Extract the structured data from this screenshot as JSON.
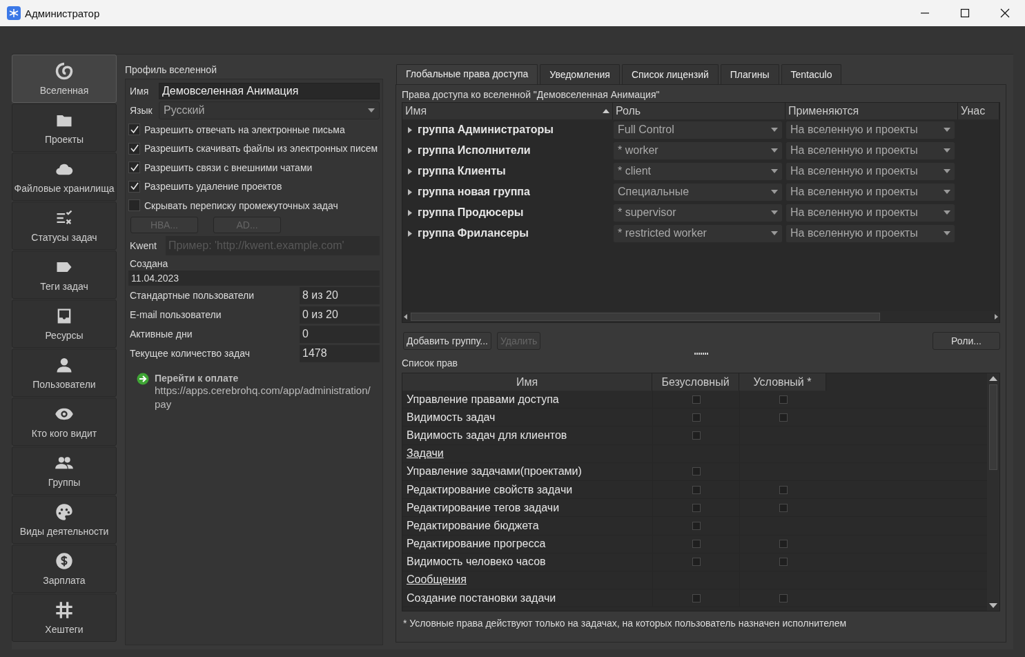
{
  "window": {
    "title": "Администратор"
  },
  "sidebar": {
    "items": [
      {
        "label": "Вселенная",
        "selected": true
      },
      {
        "label": "Проекты",
        "selected": false
      },
      {
        "label": "Файловые хранилища",
        "selected": false
      },
      {
        "label": "Статусы задач",
        "selected": false
      },
      {
        "label": "Теги задач",
        "selected": false
      },
      {
        "label": "Ресурсы",
        "selected": false
      },
      {
        "label": "Пользователи",
        "selected": false
      },
      {
        "label": "Кто кого видит",
        "selected": false
      },
      {
        "label": "Группы",
        "selected": false
      },
      {
        "label": "Виды деятельности",
        "selected": false
      },
      {
        "label": "Зарплата",
        "selected": false
      },
      {
        "label": "Хештеги",
        "selected": false
      }
    ]
  },
  "profile": {
    "title": "Профиль вселенной",
    "name": {
      "label": "Имя",
      "value": "Демовселенная Анимация"
    },
    "language": {
      "label": "Язык",
      "value": "Русский"
    },
    "options": [
      {
        "label": "Разрешить отвечать на электронные письма",
        "checked": true
      },
      {
        "label": "Разрешить скачивать файлы из электронных писем",
        "checked": true
      },
      {
        "label": "Разрешить связи с внешними чатами",
        "checked": true
      },
      {
        "label": "Разрешить удаление проектов",
        "checked": true
      },
      {
        "label": "Скрывать переписку промежуточных задач",
        "checked": false
      }
    ],
    "buttons": [
      {
        "label": "НВА...",
        "disabled": true
      },
      {
        "label": "AD...",
        "disabled": true
      }
    ],
    "kwent": {
      "label": "Kwent",
      "placeholder": "Пример: 'http://kwent.example.com'"
    },
    "created": {
      "label": "Создана",
      "value": "11.04.2023"
    },
    "stats": [
      {
        "label": "Стандартные пользователи",
        "value": "8 из 20"
      },
      {
        "label": "E-mail пользователи",
        "value": "0 из 20"
      },
      {
        "label": "Активные дни",
        "value": "0"
      },
      {
        "label": "Текущее количество задач",
        "value": "1478"
      }
    ],
    "payment": {
      "title": "Перейти к оплате",
      "url": "https://apps.cerebrohq.com/app/administration/pay"
    }
  },
  "tabs": [
    {
      "label": "Глобальные права доступа",
      "selected": true
    },
    {
      "label": "Уведомления",
      "selected": false
    },
    {
      "label": "Список лицензий",
      "selected": false
    },
    {
      "label": "Плагины",
      "selected": false
    },
    {
      "label": "Tentaculo",
      "selected": false
    }
  ],
  "access": {
    "title": "Права доступа ко вселенной \"Демовселенная Анимация\"",
    "columns": [
      {
        "label": "Имя",
        "sorted": true
      },
      {
        "label": "Роль",
        "sorted": false
      },
      {
        "label": "Применяются",
        "sorted": false
      },
      {
        "label": "Унас",
        "sorted": false
      }
    ],
    "rows": [
      {
        "name": "группа Администраторы",
        "role": "Full Control",
        "applies": "На вселенную и проекты",
        "expanded": false
      },
      {
        "name": "группа Исполнители",
        "role": "* worker",
        "applies": "На вселенную и проекты",
        "expanded": false
      },
      {
        "name": "группа Клиенты",
        "role": "* client",
        "applies": "На вселенную и проекты",
        "expanded": false
      },
      {
        "name": "группа новая группа",
        "role": "Специальные",
        "applies": "На вселенную и проекты",
        "expanded": false
      },
      {
        "name": "группа Продюсеры",
        "role": "* supervisor",
        "applies": "На вселенную и проекты",
        "expanded": false
      },
      {
        "name": "группа Фрилансеры",
        "role": "* restricted worker",
        "applies": "На вселенную и проекты",
        "expanded": false
      }
    ],
    "buttons": [
      {
        "label": "Добавить группу...",
        "disabled": false
      },
      {
        "label": "Удалить",
        "disabled": true
      },
      {
        "label": "Роли...",
        "disabled": false
      }
    ]
  },
  "rights": {
    "title": "Список прав",
    "columns": [
      "Имя",
      "Безусловный",
      "Условный *"
    ],
    "rows": [
      {
        "kind": "right",
        "name": "Управление правами доступа",
        "unconditional": false,
        "conditional": false
      },
      {
        "kind": "right",
        "name": "Видимость задач",
        "unconditional": false,
        "conditional": false
      },
      {
        "kind": "right",
        "name": "Видимость задач для клиентов",
        "unconditional": false
      },
      {
        "kind": "section",
        "name": "Задачи"
      },
      {
        "kind": "right",
        "name": "Управление задачами(проектами)",
        "unconditional": false
      },
      {
        "kind": "right",
        "name": "Редактирование свойств задачи",
        "unconditional": false,
        "conditional": false
      },
      {
        "kind": "right",
        "name": "Редактирование тегов задачи",
        "unconditional": false,
        "conditional": false
      },
      {
        "kind": "right",
        "name": "Редактирование бюджета",
        "unconditional": false
      },
      {
        "kind": "right",
        "name": "Редактирование прогресса",
        "unconditional": false,
        "conditional": false
      },
      {
        "kind": "right",
        "name": "Видимость человеко часов",
        "unconditional": false,
        "conditional": false
      },
      {
        "kind": "section",
        "name": "Сообщения"
      },
      {
        "kind": "right",
        "name": "Создание постановки задачи",
        "unconditional": false,
        "conditional": false
      }
    ],
    "footnote": "* Условные права действуют только на задачах, на которых пользователь назначен исполнителем"
  }
}
